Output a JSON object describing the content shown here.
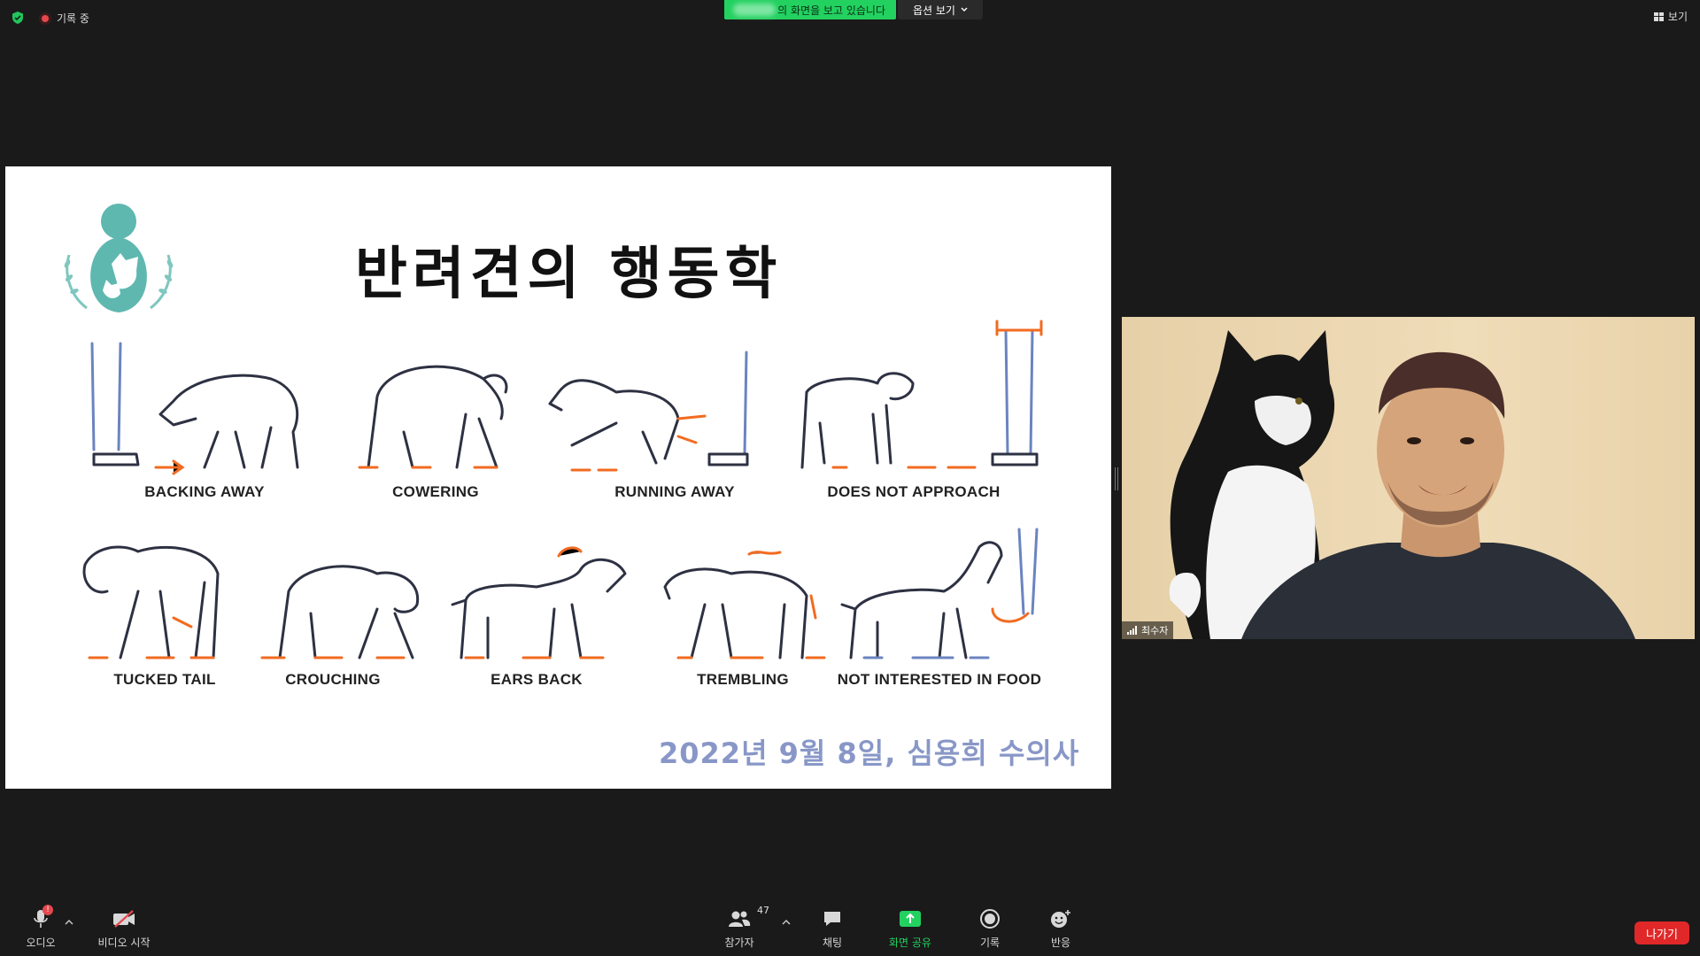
{
  "topbar": {
    "recording_label": "기록 중",
    "share_banner_text": "의 화면을 보고 있습니다",
    "options_label": "옵션 보기",
    "view_label": "보기"
  },
  "slide": {
    "title": "반려견의 행동학",
    "date_line": "2022년 9월 8일, 심용희 수의사",
    "behaviors_row1": [
      "BACKING AWAY",
      "COWERING",
      "RUNNING AWAY",
      "DOES NOT APPROACH"
    ],
    "behaviors_row2": [
      "TUCKED TAIL",
      "CROUCHING",
      "EARS BACK",
      "TREMBLING",
      "NOT INTERESTED IN FOOD"
    ],
    "colors": {
      "line": "#2d3142",
      "accent": "#f26b21",
      "human": "#6b84c0",
      "logo": "#5fb8b0"
    }
  },
  "participant": {
    "name": "최수자"
  },
  "toolbar": {
    "audio_label": "오디오",
    "audio_badge": "!",
    "video_label": "비디오 시작",
    "participants_label": "참가자",
    "participants_count": "47",
    "chat_label": "채팅",
    "share_label": "화면 공유",
    "record_label": "기록",
    "reactions_label": "반응",
    "leave_label": "나가기",
    "share_accent": "#23d160"
  }
}
